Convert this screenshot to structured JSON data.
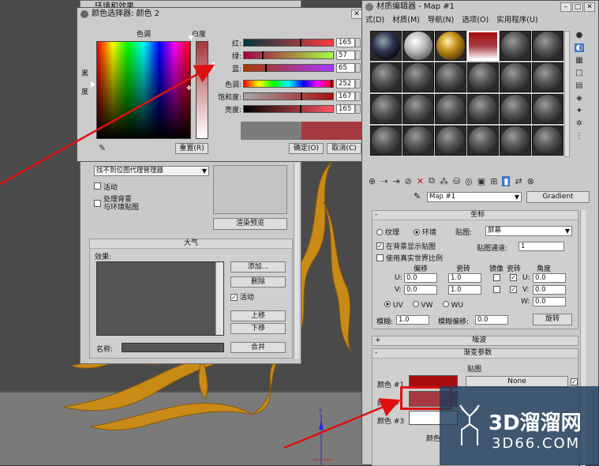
{
  "render_window": {
    "title": "环境和效果",
    "proxy_select": "找不到位图代理管理器",
    "active_label": "活动",
    "bg_processing_label": "处理背景\n与环境贴图",
    "render_preview_btn": "渲染预览",
    "atmosphere_title": "大气",
    "effects_label": "效果:",
    "add_btn": "添加...",
    "delete_btn": "删除",
    "active_check_label": "活动",
    "move_up_btn": "上移",
    "move_down_btn": "下移",
    "name_label": "名称:",
    "merge_btn": "合并"
  },
  "color_picker": {
    "title": "颜色选择器: 颜色 2",
    "hue_label": "色调",
    "whiteness_label": "白度",
    "blackness_label": "黑",
    "blackness_label2": "度",
    "red_label": "红:",
    "green_label": "绿:",
    "blue_label": "蓝:",
    "hue_s_label": "色调:",
    "sat_label": "饱和度:",
    "val_label": "亮度:",
    "red": "165",
    "green": "57",
    "blue": "65",
    "hue": "252",
    "sat": "167",
    "val": "165",
    "red_level": 0.647,
    "green_level": 0.224,
    "blue_level": 0.255,
    "hue_level": 0.988,
    "sat_level": 0.655,
    "val_level": 0.647,
    "reset_btn": "重置(R)",
    "ok_btn": "确定(O)",
    "cancel_btn": "取消(C)",
    "old_color": "#7c7c7c",
    "new_color": "#a53941"
  },
  "material_editor": {
    "title": "材质编辑器 - Map #1",
    "menus": [
      "式(D)",
      "材质(M)",
      "导航(N)",
      "选项(O)",
      "实用程序(U)"
    ],
    "map_name": "Map #1",
    "map_type_btn": "Gradient",
    "coords_title": "坐标",
    "texture_label": "纹理",
    "env_label": "环境",
    "mapping_label": "贴图:",
    "mapping_value": "屏幕",
    "show_bg_label": "在背景显示贴图",
    "real_world_label": "使用真实世界比例",
    "map_channel_label": "贴图通道:",
    "map_channel_value": "1",
    "offset_label": "偏移",
    "tiling_label": "瓷砖",
    "mirror_label": "镜像",
    "tile_label": "瓷砖",
    "angle_label": "角度",
    "u_label": "U:",
    "v_label": "V:",
    "w_label": "W:",
    "u_offset": "0.0",
    "u_tiling": "1.0",
    "u_angle": "0.0",
    "v_offset": "0.0",
    "v_tiling": "1.0",
    "v_angle": "0.0",
    "w_angle": "0.0",
    "uv_label": "UV",
    "vw_label": "VW",
    "wu_label": "WU",
    "blur_label": "模糊:",
    "blur_value": "1.0",
    "blur_offset_label": "模糊偏移:",
    "blur_offset_value": "0.0",
    "rotate_btn": "旋转",
    "noise_title": "噪波",
    "gradient_params_title": "渐变参数",
    "map_col_label": "贴图",
    "color1_label": "颜色 #1",
    "color2_label": "颜色 #",
    "color3_label": "颜色 #3",
    "none_btn": "None",
    "color2_pos_label": "颜色",
    "color1": "#a80d0d",
    "color2": "#a53941",
    "color3": "#ffffff"
  },
  "watermark": {
    "brand": "3D溜溜网",
    "url": "3D66.COM"
  },
  "colors": {
    "arrow_red": "#e01010",
    "selected_blue": "#3f78c4"
  }
}
